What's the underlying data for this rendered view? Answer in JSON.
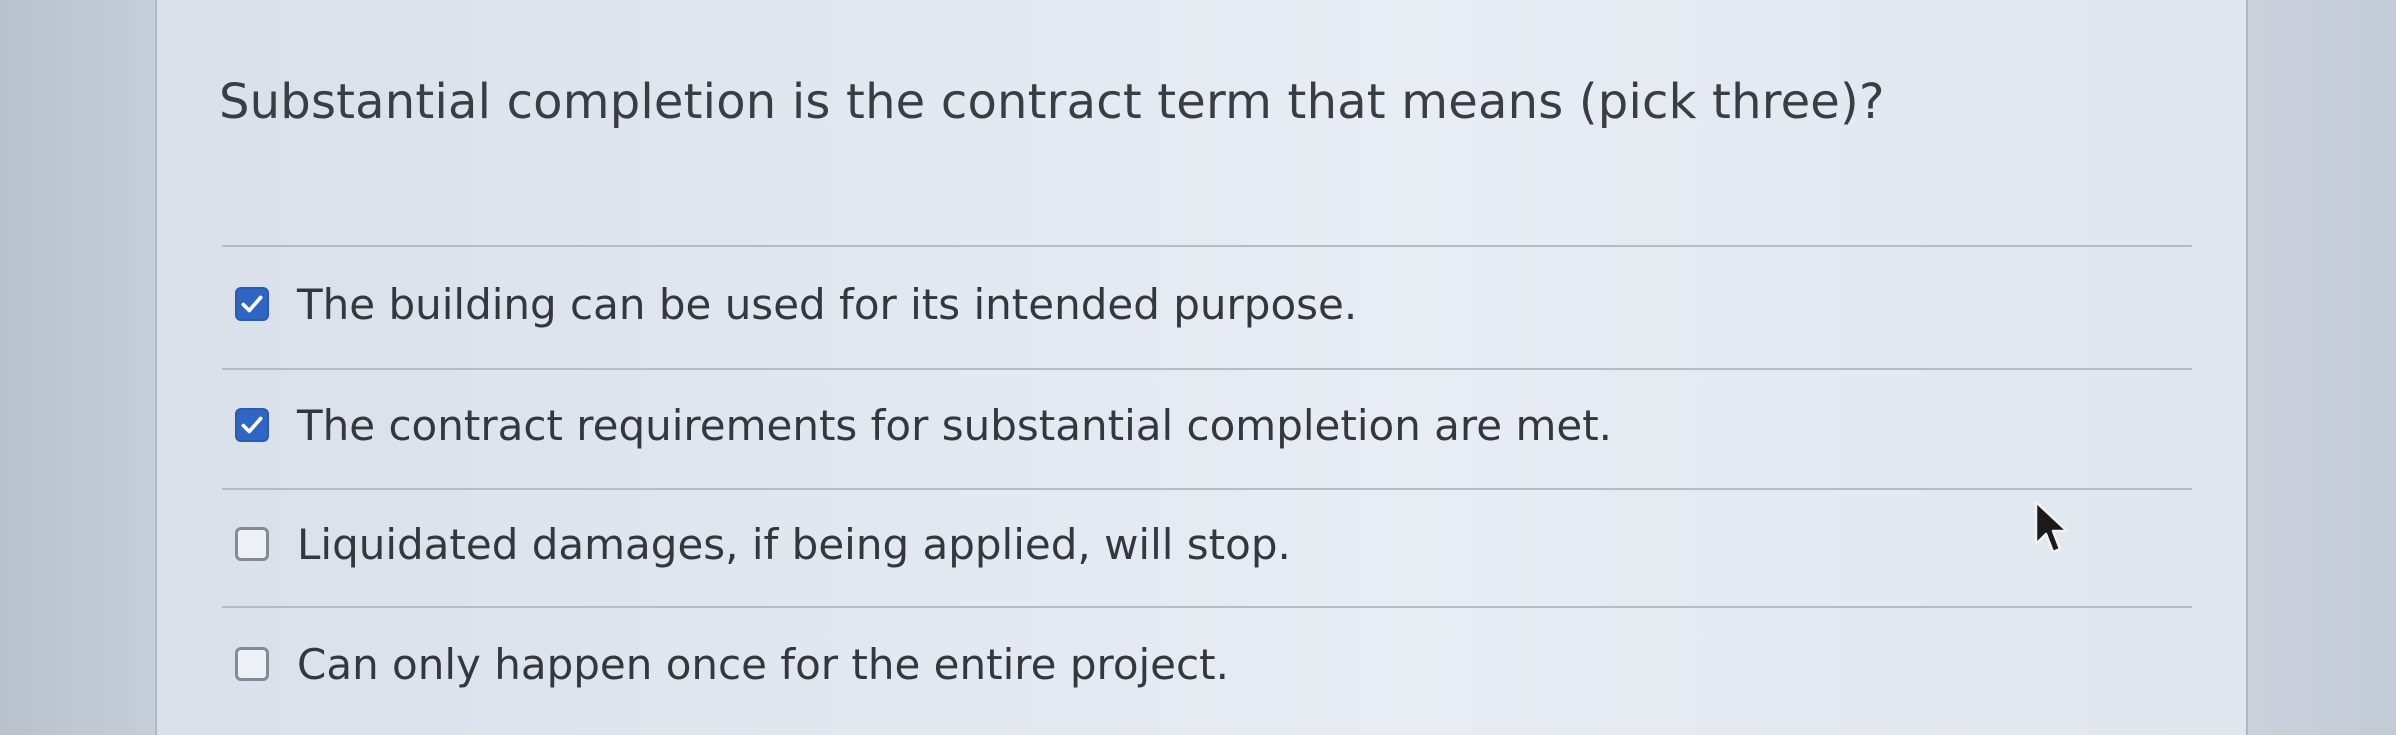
{
  "question": {
    "text": "Substantial completion is the contract term that means (pick three)?"
  },
  "options": [
    {
      "label": "The building can be used for its intended purpose.",
      "checked": true
    },
    {
      "label": "The contract requirements for substantial completion are met.",
      "checked": true
    },
    {
      "label": "Liquidated damages, if being applied, will stop.",
      "checked": false
    },
    {
      "label": "Can only happen once for the entire project.",
      "checked": false
    }
  ],
  "icons": {
    "checked": "checkmark-icon",
    "cursor": "mouse-pointer-icon"
  },
  "colors": {
    "checkbox_checked": "#2f66c4",
    "checkbox_unchecked_border": "#858b93",
    "text": "#34373c"
  }
}
